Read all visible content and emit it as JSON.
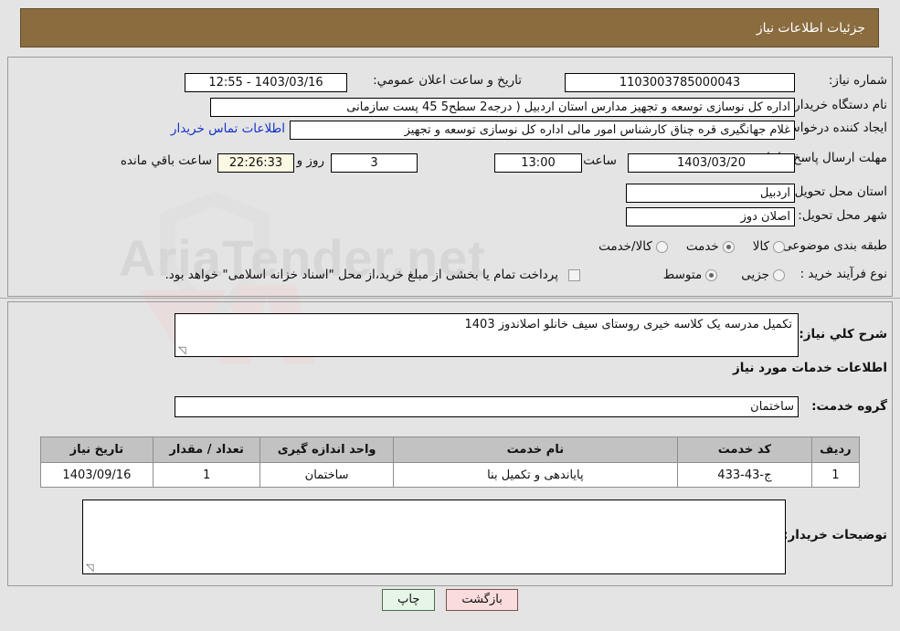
{
  "header": {
    "title": "جزئیات اطلاعات نیاز"
  },
  "fields": {
    "need_number_label": "شماره نیاز:",
    "need_number_value": "1103003785000043",
    "announce_label": "تاریخ و ساعت اعلان عمومي:",
    "announce_value": "1403/03/16 - 12:55",
    "buyer_org_label": "نام دستگاه خریدار:",
    "buyer_org_value": "اداره کل نوسازی   توسعه و تجهیز مدارس استان اردبیل ( درجه2  سطح5  45 پست سازمانی",
    "creator_label": "ایجاد کننده درخواست:",
    "creator_value": "غلام جهانگیری قره چناق کارشناس امور مالی اداره کل نوسازی   توسعه و تجهیز",
    "contact_link": "اطلاعات تماس خریدار",
    "deadline_label": "مهلت ارسال پاسخ: تا تاریخ:",
    "deadline_date": "1403/03/20",
    "time_label": "ساعت",
    "time_value": "13:00",
    "days_value": "3",
    "days_label": "روز و",
    "countdown_value": "22:26:33",
    "remaining_label": "ساعت باقي مانده",
    "province_label": "استان محل تحویل:",
    "province_value": "اردبیل",
    "city_label": "شهر محل تحویل:",
    "city_value": "اصلان دوز",
    "category_label": "طبقه بندی موضوعی:",
    "process_label": "نوع فرآیند خرید :",
    "treasury_note": "پرداخت تمام یا بخشی از مبلغ خرید،از محل \"اسناد خزانه اسلامی\" خواهد بود."
  },
  "category_options": [
    {
      "label": "کالا",
      "selected": false
    },
    {
      "label": "خدمت",
      "selected": true
    },
    {
      "label": "کالا/خدمت",
      "selected": false
    }
  ],
  "process_options": [
    {
      "label": "جزیی",
      "selected": false
    },
    {
      "label": "متوسط",
      "selected": true
    }
  ],
  "description": {
    "label": "شرح کلي نیاز:",
    "value": "تکمیل مدرسه یک کلاسه خیری روستای سیف خانلو اصلاندوز 1403"
  },
  "services_section": {
    "heading": "اطلاعات خدمات مورد نیاز",
    "group_label": "گروه خدمت:",
    "group_value": "ساختمان"
  },
  "table": {
    "columns": [
      "ردیف",
      "کد خدمت",
      "نام خدمت",
      "واحد اندازه گیری",
      "تعداد / مقدار",
      "تاریخ نیاز"
    ],
    "rows": [
      {
        "row_no": "1",
        "service_code": "ج-43-433",
        "service_name": "پایاندهی و تکمیل بنا",
        "unit": "ساختمان",
        "quantity": "1",
        "need_date": "1403/09/16"
      }
    ]
  },
  "buyer_comments": {
    "label": "توضیحات خریدار:",
    "value": ""
  },
  "buttons": {
    "back": "بازگشت",
    "print": "چاپ"
  },
  "watermark": {
    "text": "AriaTender.net"
  },
  "colors": {
    "header_bar": "#8a6c3f",
    "page_bg": "#e4e4e4",
    "table_header": "#c2c2c2",
    "link": "#1432c8",
    "countdown_bg": "#fbf8e3",
    "back_button_bg": "#fbdcdc",
    "print_button_bg": "#e6f5e6"
  }
}
